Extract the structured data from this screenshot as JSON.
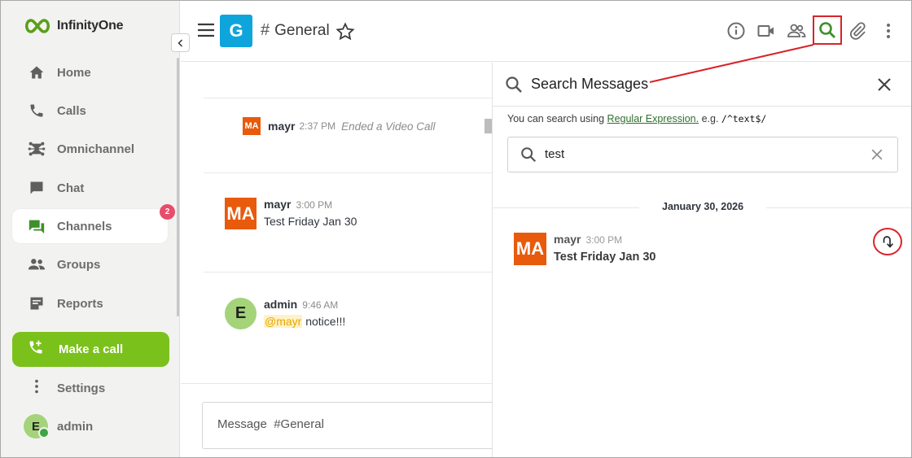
{
  "app": {
    "brand": "InfinityOne"
  },
  "sidebar": {
    "items": [
      {
        "label": "Home",
        "icon": "home-icon"
      },
      {
        "label": "Calls",
        "icon": "phone-icon"
      },
      {
        "label": "Omnichannel",
        "icon": "omnichannel-icon"
      },
      {
        "label": "Chat",
        "icon": "chat-icon"
      },
      {
        "label": "Channels",
        "icon": "channels-icon",
        "badge": "2",
        "active": true
      },
      {
        "label": "Groups",
        "icon": "groups-icon"
      },
      {
        "label": "Reports",
        "icon": "reports-icon"
      }
    ],
    "make_call": "Make a call",
    "settings": "Settings",
    "user": {
      "initial": "E",
      "name": "admin"
    }
  },
  "header": {
    "room_initial": "G",
    "room_hash": "#",
    "room_name": "General"
  },
  "messages": {
    "system_msg": {
      "initials": "MA",
      "author": "mayr",
      "time": "2:37 PM",
      "text": "Ended a Video Call"
    },
    "list": [
      {
        "initials": "MA",
        "author": "mayr",
        "time": "3:00 PM",
        "text": "Test Friday Jan 30"
      },
      {
        "initials": "E",
        "author": "admin",
        "time": "9:46 AM",
        "mention": "@mayr",
        "text": " notice!!!"
      }
    ]
  },
  "composer": {
    "placeholder": "Message  #General"
  },
  "search_panel": {
    "title": "Search Messages",
    "hint_prefix": "You can search using ",
    "hint_link": "Regular Expression.",
    "hint_mid": " e.g. ",
    "hint_code": "/^text$/",
    "query": "test",
    "date": "January 30, 2026",
    "result": {
      "initials": "MA",
      "author": "mayr",
      "time": "3:00 PM",
      "text": "Test Friday Jan 30"
    }
  },
  "colors": {
    "brand_green": "#7ac11c",
    "room_blue": "#0ea5dc",
    "avatar_orange": "#e85a0c",
    "annotation_red": "#d8232a",
    "badge_pink": "#e84d6a"
  }
}
